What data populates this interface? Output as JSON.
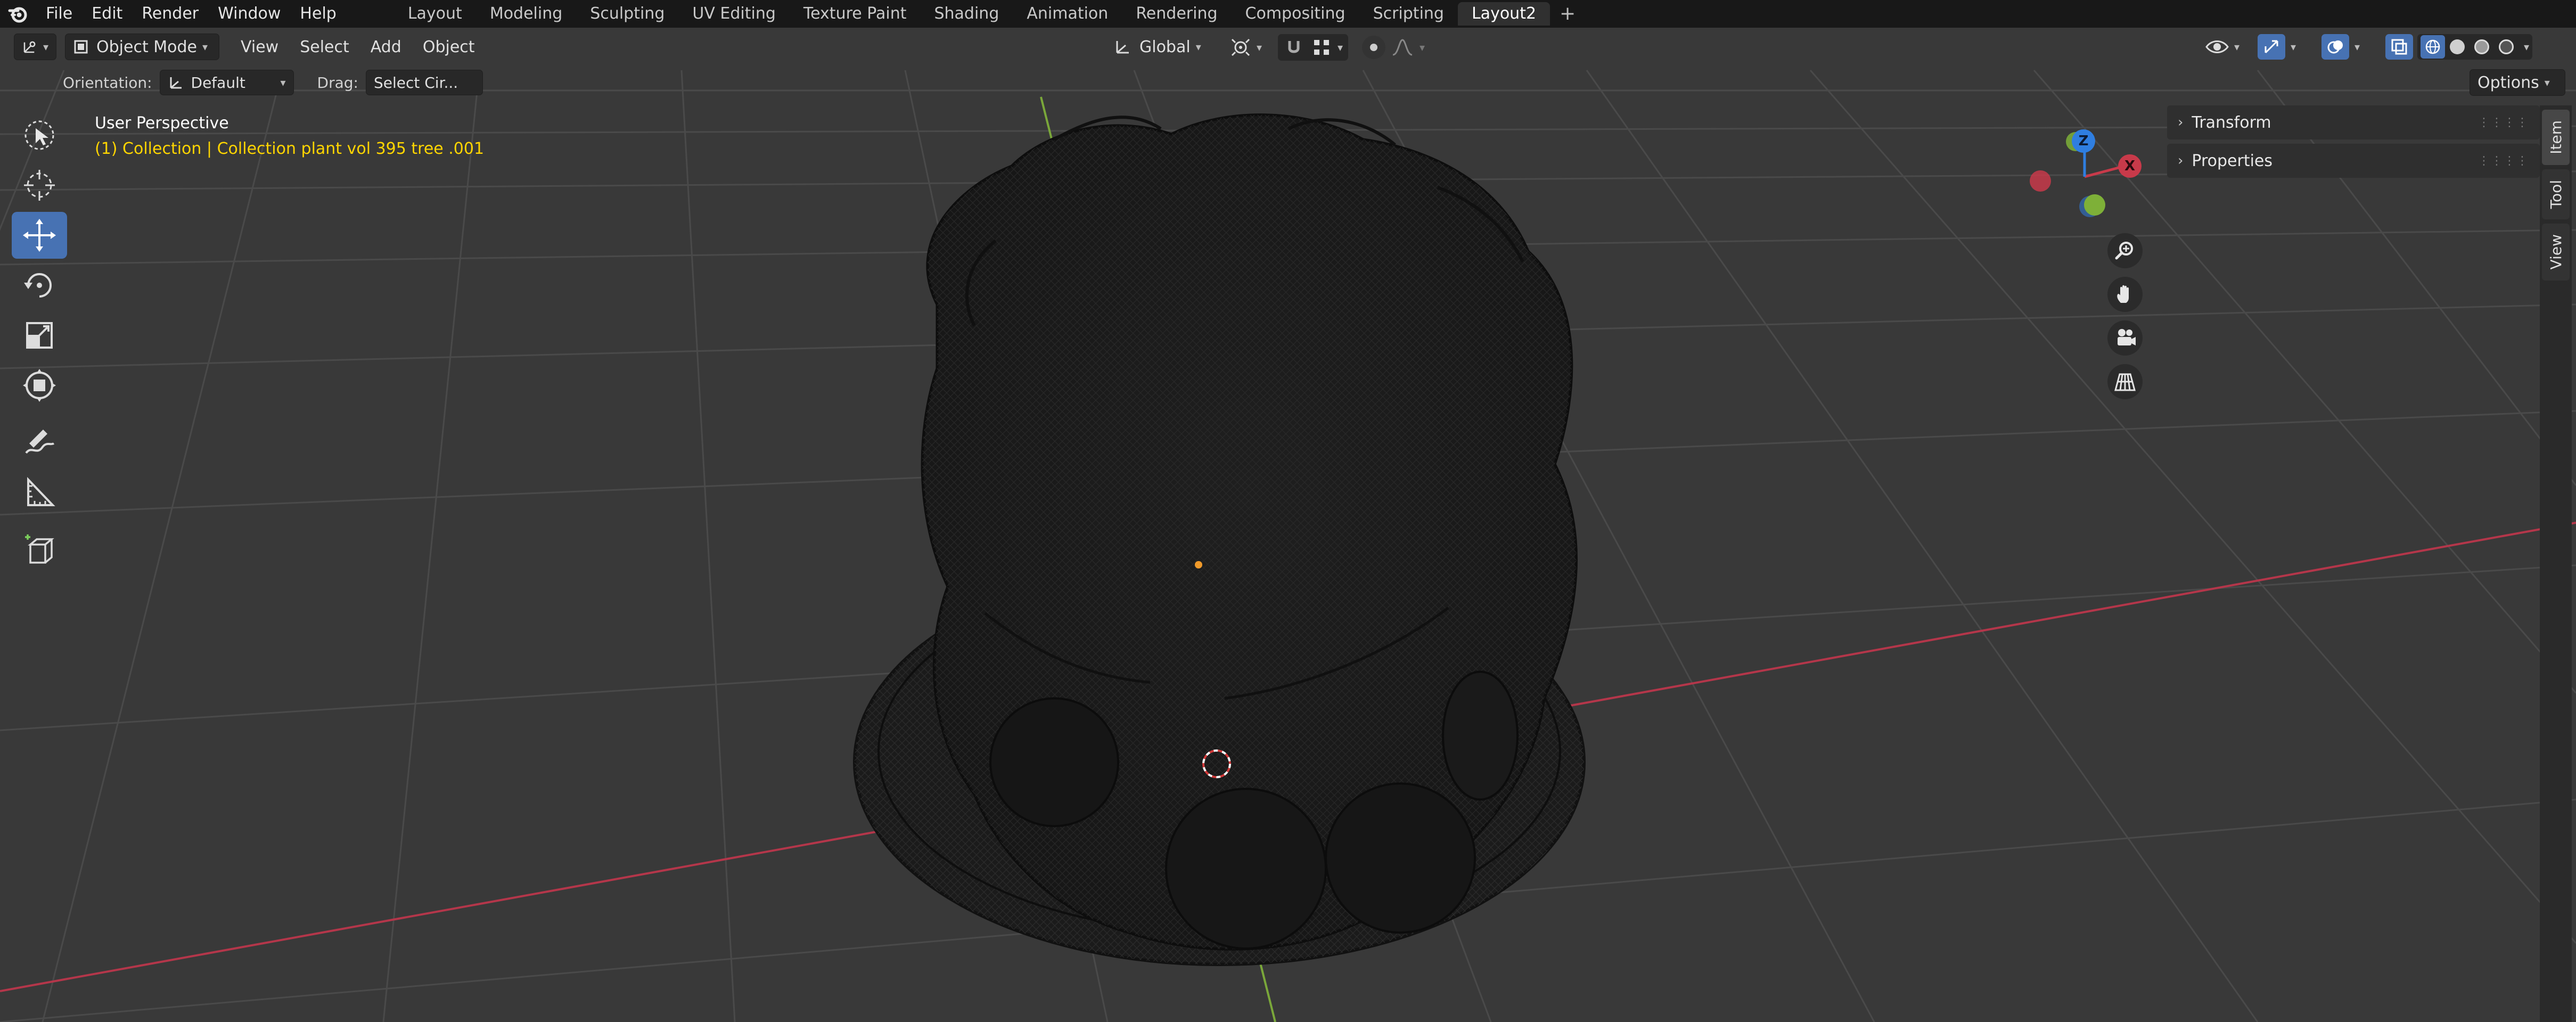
{
  "app": {
    "name": "Blender"
  },
  "menu": {
    "items": [
      "File",
      "Edit",
      "Render",
      "Window",
      "Help"
    ]
  },
  "workspaces": {
    "tabs": [
      "Layout",
      "Modeling",
      "Sculpting",
      "UV Editing",
      "Texture Paint",
      "Shading",
      "Animation",
      "Rendering",
      "Compositing",
      "Scripting",
      "Layout2"
    ],
    "active": "Layout2",
    "add_label": "+"
  },
  "header": {
    "mode": "Object Mode",
    "view": "View",
    "select": "Select",
    "add": "Add",
    "object": "Object",
    "transform_orientation": "Global",
    "options": "Options"
  },
  "tool_settings": {
    "orientation_label": "Orientation:",
    "orientation_value": "Default",
    "drag_label": "Drag:",
    "drag_value": "Select Cir..."
  },
  "viewport": {
    "view_name": "User Perspective",
    "collection_text": "(1) Collection | Collection plant vol 395 tree .001"
  },
  "gizmo": {
    "z": "Z",
    "x": "X"
  },
  "sidebar": {
    "panels": [
      {
        "label": "Transform"
      },
      {
        "label": "Properties"
      }
    ],
    "tabs": [
      "Item",
      "Tool",
      "View"
    ],
    "active_tab": "Item"
  },
  "tools": [
    "select-box-icon",
    "cursor-icon",
    "move-icon",
    "rotate-icon",
    "scale-icon",
    "transform-icon",
    "annotate-icon",
    "measure-icon",
    "add-cube-icon"
  ],
  "colors": {
    "accent": "#4772b3",
    "collection_text": "#ffd500",
    "x_axis": "#c83a4a",
    "y_axis": "#7eb038",
    "z_axis": "#2f7ee0",
    "viewport_bg": "#393939"
  }
}
